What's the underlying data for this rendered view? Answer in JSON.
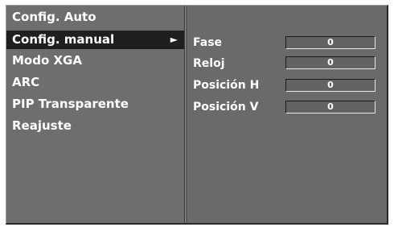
{
  "menu": {
    "items": [
      {
        "label": "Config. Auto",
        "selected": false
      },
      {
        "label": "Config. manual",
        "selected": true,
        "icon": "right-arrow-icon"
      },
      {
        "label": "Modo XGA",
        "selected": false
      },
      {
        "label": "ARC",
        "selected": false
      },
      {
        "label": "PIP Transparente",
        "selected": false
      },
      {
        "label": "Reajuste",
        "selected": false
      }
    ],
    "arrow_glyph": "►"
  },
  "manual_config": {
    "params": [
      {
        "label": "Fase",
        "value": "0"
      },
      {
        "label": "Reloj",
        "value": "0"
      },
      {
        "label": "Posición H",
        "value": "0"
      },
      {
        "label": "Posición V",
        "value": "0"
      }
    ]
  },
  "colors": {
    "panel_bg": "#6e6e6e",
    "selected_bg": "#1f1f1f",
    "text": "#ffffff"
  }
}
